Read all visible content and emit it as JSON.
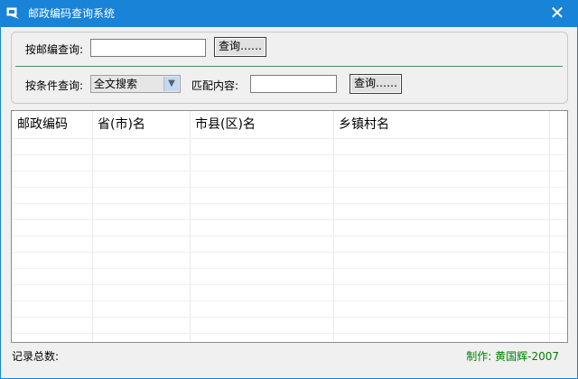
{
  "window": {
    "title": "邮政编码查询系统",
    "close_glyph": "✕"
  },
  "search_panel": {
    "zip_label": "按邮编查询:",
    "zip_value": "",
    "zip_button": "查询……",
    "condition_label": "按条件查询:",
    "condition_selected": "全文搜索",
    "match_label": "匹配内容:",
    "match_value": "",
    "match_button": "查询……"
  },
  "table": {
    "columns": [
      "邮政编码",
      "省(市)名",
      "市县(区)名",
      "乡镇村名"
    ],
    "rows": []
  },
  "footer": {
    "record_count_label": "记录总数:",
    "credit": "制作: 黄国辉-2007",
    "credit_color": "#008000"
  },
  "colors": {
    "titlebar": "#1883d7"
  }
}
